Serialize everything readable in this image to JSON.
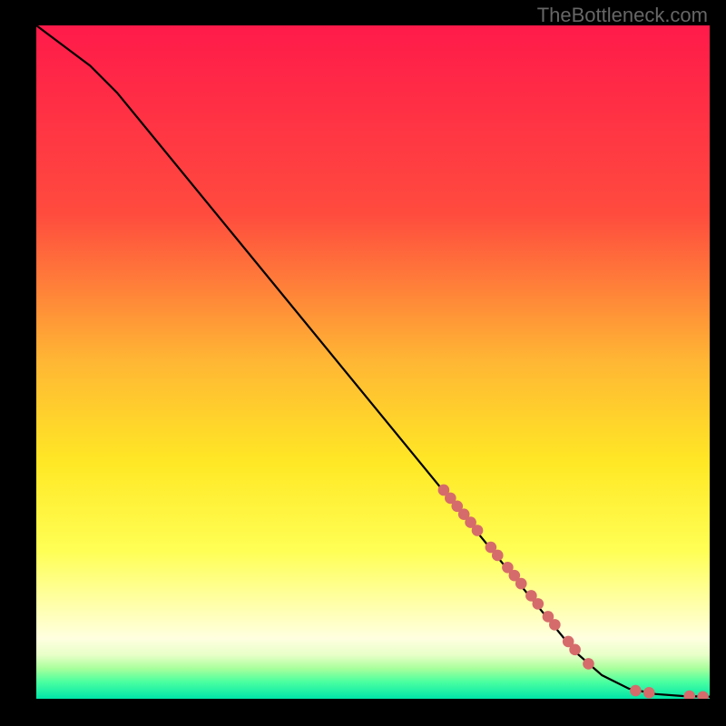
{
  "watermark": "TheBottleneck.com",
  "chart_data": {
    "type": "line",
    "title": "",
    "xlabel": "",
    "ylabel": "",
    "xlim": [
      0,
      100
    ],
    "ylim": [
      0,
      100
    ],
    "gradient_stops": [
      {
        "offset": 0,
        "color": "#ff1a4a"
      },
      {
        "offset": 28,
        "color": "#ff4b3e"
      },
      {
        "offset": 50,
        "color": "#ffb734"
      },
      {
        "offset": 65,
        "color": "#ffe825"
      },
      {
        "offset": 78,
        "color": "#ffff55"
      },
      {
        "offset": 86,
        "color": "#ffffaa"
      },
      {
        "offset": 91,
        "color": "#ffffe0"
      },
      {
        "offset": 93.5,
        "color": "#e8ffc8"
      },
      {
        "offset": 95.5,
        "color": "#a8ff9c"
      },
      {
        "offset": 97.5,
        "color": "#4affa0"
      },
      {
        "offset": 100,
        "color": "#00e5a8"
      }
    ],
    "series": [
      {
        "name": "curve",
        "type": "line",
        "points": [
          {
            "x": 0,
            "y": 100
          },
          {
            "x": 4,
            "y": 97
          },
          {
            "x": 8,
            "y": 94
          },
          {
            "x": 12,
            "y": 90
          },
          {
            "x": 80,
            "y": 7
          },
          {
            "x": 84,
            "y": 3.5
          },
          {
            "x": 88,
            "y": 1.5
          },
          {
            "x": 92,
            "y": 0.7
          },
          {
            "x": 96,
            "y": 0.4
          },
          {
            "x": 100,
            "y": 0.3
          }
        ]
      },
      {
        "name": "markers",
        "type": "scatter",
        "points": [
          {
            "x": 60.5,
            "y": 31,
            "r": 6
          },
          {
            "x": 61.5,
            "y": 29.8,
            "r": 6
          },
          {
            "x": 62.5,
            "y": 28.6,
            "r": 6
          },
          {
            "x": 63.5,
            "y": 27.4,
            "r": 6
          },
          {
            "x": 64.5,
            "y": 26.2,
            "r": 6
          },
          {
            "x": 65.5,
            "y": 25,
            "r": 6
          },
          {
            "x": 67.5,
            "y": 22.5,
            "r": 6
          },
          {
            "x": 68.5,
            "y": 21.3,
            "r": 6
          },
          {
            "x": 70,
            "y": 19.5,
            "r": 6
          },
          {
            "x": 71,
            "y": 18.3,
            "r": 6
          },
          {
            "x": 72,
            "y": 17.1,
            "r": 6
          },
          {
            "x": 73.5,
            "y": 15.3,
            "r": 6
          },
          {
            "x": 74.5,
            "y": 14.1,
            "r": 6
          },
          {
            "x": 76,
            "y": 12.2,
            "r": 6
          },
          {
            "x": 77,
            "y": 11,
            "r": 6
          },
          {
            "x": 79,
            "y": 8.5,
            "r": 6
          },
          {
            "x": 80,
            "y": 7.3,
            "r": 6
          },
          {
            "x": 82,
            "y": 5.2,
            "r": 6
          },
          {
            "x": 89,
            "y": 1.2,
            "r": 6
          },
          {
            "x": 91,
            "y": 0.9,
            "r": 6
          },
          {
            "x": 97,
            "y": 0.4,
            "r": 6
          },
          {
            "x": 99,
            "y": 0.3,
            "r": 6
          }
        ]
      }
    ]
  }
}
